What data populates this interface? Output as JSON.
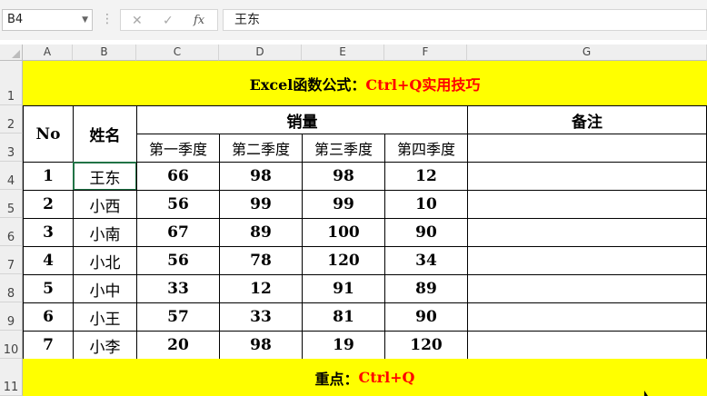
{
  "formula_bar": {
    "name_box": "B4",
    "cancel_icon": "✕",
    "enter_icon": "✓",
    "fx_label": "fx",
    "content": "王东"
  },
  "columns": [
    "A",
    "B",
    "C",
    "D",
    "E",
    "F",
    "G"
  ],
  "rows": [
    "1",
    "2",
    "3",
    "4",
    "5",
    "6",
    "7",
    "8",
    "9",
    "10",
    "11"
  ],
  "title": {
    "part1": "Excel函数公式：",
    "part2": "Ctrl+Q实用技巧"
  },
  "table": {
    "no_header": "No",
    "name_header": "姓名",
    "sales_header": "销量",
    "remark_header": "备注",
    "quarters": [
      "第一季度",
      "第二季度",
      "第三季度",
      "第四季度"
    ],
    "rows": [
      {
        "no": "1",
        "name": "王东",
        "q1": "66",
        "q2": "98",
        "q3": "98",
        "q4": "12"
      },
      {
        "no": "2",
        "name": "小西",
        "q1": "56",
        "q2": "99",
        "q3": "99",
        "q4": "10"
      },
      {
        "no": "3",
        "name": "小南",
        "q1": "67",
        "q2": "89",
        "q3": "100",
        "q4": "90"
      },
      {
        "no": "4",
        "name": "小北",
        "q1": "56",
        "q2": "78",
        "q3": "120",
        "q4": "34"
      },
      {
        "no": "5",
        "name": "小中",
        "q1": "33",
        "q2": "12",
        "q3": "91",
        "q4": "89"
      },
      {
        "no": "6",
        "name": "小王",
        "q1": "57",
        "q2": "33",
        "q3": "81",
        "q4": "90"
      },
      {
        "no": "7",
        "name": "小李",
        "q1": "20",
        "q2": "98",
        "q3": "19",
        "q4": "120"
      }
    ]
  },
  "footer": {
    "part1": "重点：",
    "part2": "Ctrl+Q"
  }
}
